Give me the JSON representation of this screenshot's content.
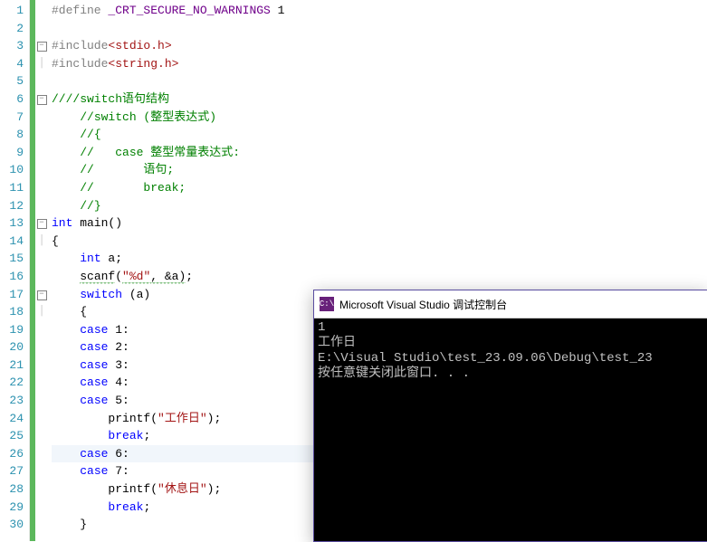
{
  "editor": {
    "line_count": 30,
    "highlighted_line": 26,
    "fold_markers": {
      "3": "minus",
      "4": "pipe",
      "6": "minus",
      "13": "minus",
      "14": "pipe",
      "17": "minus",
      "18": "pipe"
    },
    "lines": [
      {
        "n": 1,
        "tokens": [
          {
            "t": "#define",
            "c": "pp"
          },
          {
            "t": " "
          },
          {
            "t": "_CRT_SECURE_NO_WARNINGS",
            "c": "mac"
          },
          {
            "t": " 1"
          }
        ]
      },
      {
        "n": 2,
        "tokens": []
      },
      {
        "n": 3,
        "tokens": [
          {
            "t": "#include",
            "c": "pp"
          },
          {
            "t": "<stdio.h>",
            "c": "str"
          }
        ]
      },
      {
        "n": 4,
        "tokens": [
          {
            "t": "#include",
            "c": "pp"
          },
          {
            "t": "<string.h>",
            "c": "str"
          }
        ]
      },
      {
        "n": 5,
        "tokens": []
      },
      {
        "n": 6,
        "tokens": [
          {
            "t": "////switch语句结构",
            "c": "cm"
          }
        ]
      },
      {
        "n": 7,
        "indent": 1,
        "tokens": [
          {
            "t": "//switch (整型表达式)",
            "c": "cm"
          }
        ]
      },
      {
        "n": 8,
        "indent": 1,
        "tokens": [
          {
            "t": "//{",
            "c": "cm"
          }
        ]
      },
      {
        "n": 9,
        "indent": 1,
        "tokens": [
          {
            "t": "//   case 整型常量表达式:",
            "c": "cm"
          }
        ]
      },
      {
        "n": 10,
        "indent": 1,
        "tokens": [
          {
            "t": "//       语句;",
            "c": "cm"
          }
        ]
      },
      {
        "n": 11,
        "indent": 1,
        "tokens": [
          {
            "t": "//       break;",
            "c": "cm"
          }
        ]
      },
      {
        "n": 12,
        "indent": 1,
        "tokens": [
          {
            "t": "//}",
            "c": "cm"
          }
        ]
      },
      {
        "n": 13,
        "tokens": [
          {
            "t": "int",
            "c": "tp"
          },
          {
            "t": " main()"
          }
        ]
      },
      {
        "n": 14,
        "tokens": [
          {
            "t": "{"
          }
        ]
      },
      {
        "n": 15,
        "indent": 1,
        "tokens": [
          {
            "t": "int",
            "c": "tp"
          },
          {
            "t": " a;"
          }
        ]
      },
      {
        "n": 16,
        "indent": 1,
        "tokens": [
          {
            "t": "scanf",
            "squig": true
          },
          {
            "t": "("
          },
          {
            "t": "\"%d\"",
            "c": "str",
            "squig": true
          },
          {
            "t": ", &a)",
            "squig": true
          },
          {
            "t": ";"
          }
        ]
      },
      {
        "n": 17,
        "indent": 1,
        "tokens": [
          {
            "t": "switch",
            "c": "kw"
          },
          {
            "t": " (a)"
          }
        ]
      },
      {
        "n": 18,
        "indent": 1,
        "tokens": [
          {
            "t": "{"
          }
        ]
      },
      {
        "n": 19,
        "indent": 1,
        "tokens": [
          {
            "t": "case",
            "c": "kw"
          },
          {
            "t": " 1:"
          }
        ]
      },
      {
        "n": 20,
        "indent": 1,
        "tokens": [
          {
            "t": "case",
            "c": "kw"
          },
          {
            "t": " 2:"
          }
        ]
      },
      {
        "n": 21,
        "indent": 1,
        "tokens": [
          {
            "t": "case",
            "c": "kw"
          },
          {
            "t": " 3:"
          }
        ]
      },
      {
        "n": 22,
        "indent": 1,
        "tokens": [
          {
            "t": "case",
            "c": "kw"
          },
          {
            "t": " 4:"
          }
        ]
      },
      {
        "n": 23,
        "indent": 1,
        "tokens": [
          {
            "t": "case",
            "c": "kw"
          },
          {
            "t": " 5:"
          }
        ]
      },
      {
        "n": 24,
        "indent": 2,
        "tokens": [
          {
            "t": "printf("
          },
          {
            "t": "\"工作日\"",
            "c": "str"
          },
          {
            "t": ");"
          }
        ]
      },
      {
        "n": 25,
        "indent": 2,
        "tokens": [
          {
            "t": "break",
            "c": "kw"
          },
          {
            "t": ";"
          }
        ]
      },
      {
        "n": 26,
        "indent": 1,
        "tokens": [
          {
            "t": "case",
            "c": "kw"
          },
          {
            "t": " 6:"
          }
        ]
      },
      {
        "n": 27,
        "indent": 1,
        "tokens": [
          {
            "t": "case",
            "c": "kw"
          },
          {
            "t": " 7:"
          }
        ]
      },
      {
        "n": 28,
        "indent": 2,
        "tokens": [
          {
            "t": "printf("
          },
          {
            "t": "\"休息日\"",
            "c": "str"
          },
          {
            "t": ");"
          }
        ]
      },
      {
        "n": 29,
        "indent": 2,
        "tokens": [
          {
            "t": "break",
            "c": "kw"
          },
          {
            "t": ";"
          }
        ]
      },
      {
        "n": 30,
        "indent": 1,
        "tokens": [
          {
            "t": "}"
          }
        ]
      }
    ]
  },
  "console": {
    "icon_text": "C:\\",
    "title": "Microsoft Visual Studio 调试控制台",
    "lines": [
      "1",
      "工作日",
      "E:\\Visual Studio\\test_23.09.06\\Debug\\test_23",
      "按任意键关闭此窗口. . ."
    ]
  }
}
